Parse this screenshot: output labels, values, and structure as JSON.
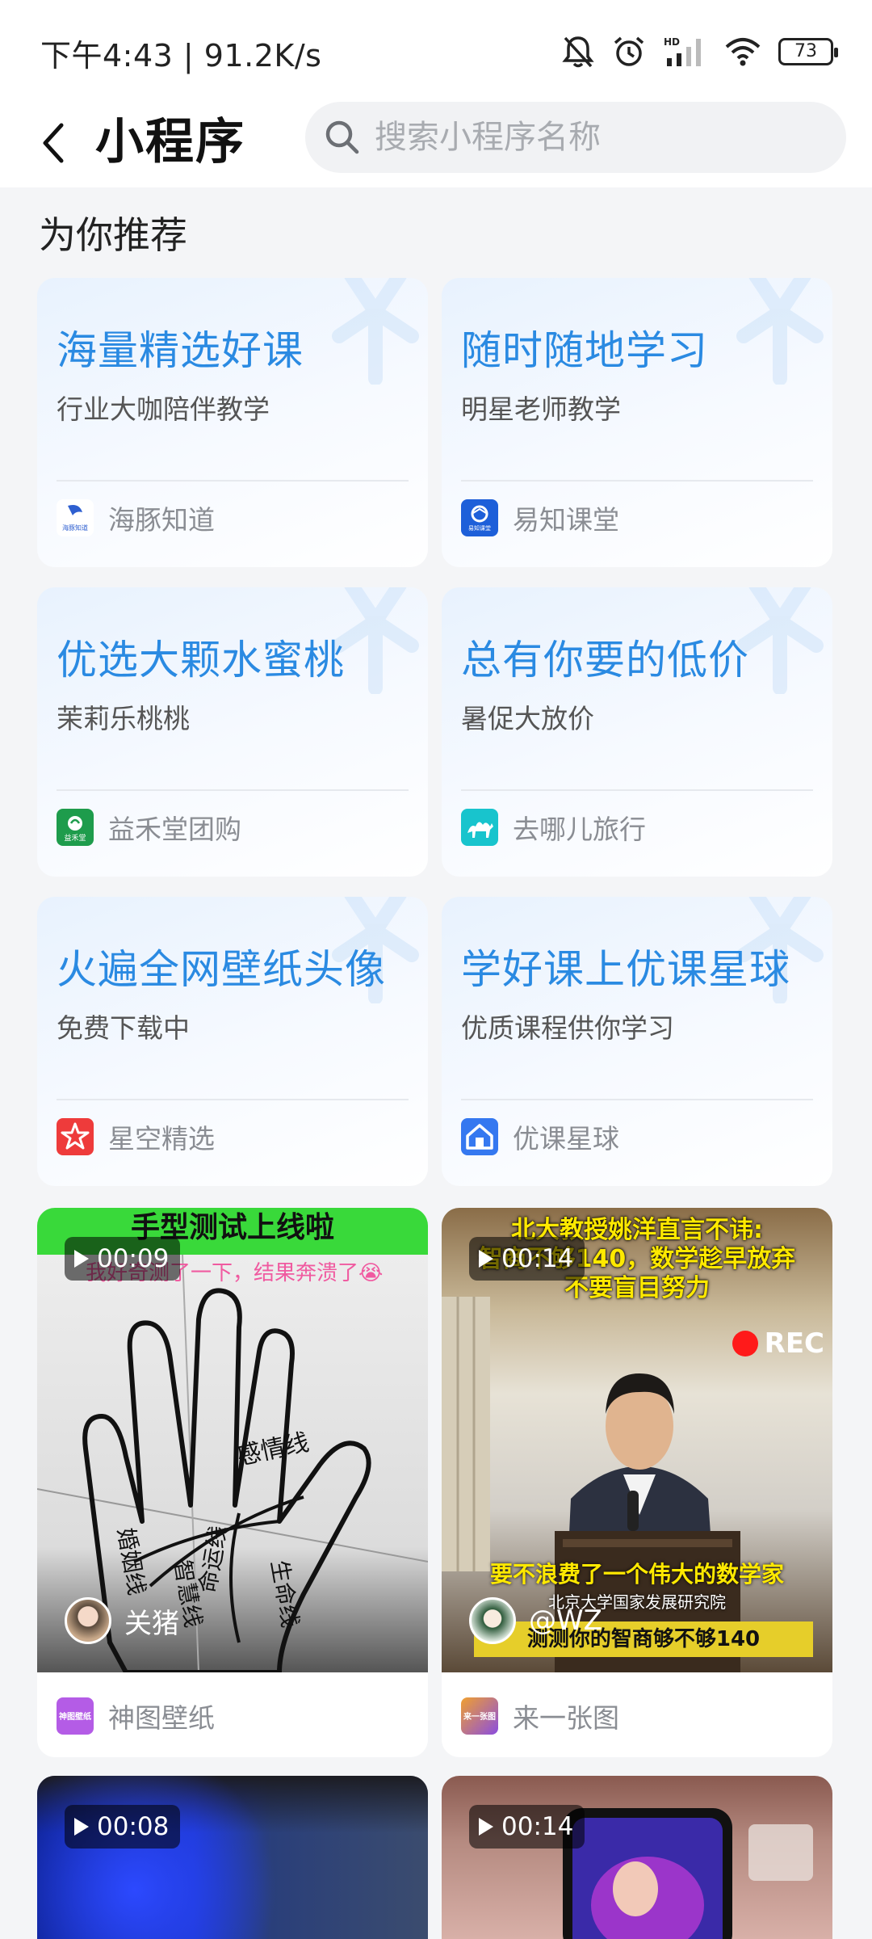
{
  "status_bar": {
    "time_speed": "下午4:43 | 91.2K/s",
    "hd": "HD",
    "battery": "73"
  },
  "header": {
    "title": "小程序",
    "search_placeholder": "搜索小程序名称"
  },
  "section": {
    "title": "为你推荐"
  },
  "recommendations": [
    {
      "title": "海量精选好课",
      "subtitle": "行业大咖陪伴教学",
      "app_name": "海豚知道",
      "icon_color": "#ffffff",
      "icon_text": "海豚知道"
    },
    {
      "title": "随时随地学习",
      "subtitle": "明星老师教学",
      "app_name": "易知课堂",
      "icon_color": "#1d5fd9",
      "icon_text": "易知课堂"
    },
    {
      "title": "优选大颗水蜜桃",
      "subtitle": "茉莉乐桃桃",
      "app_name": "益禾堂团购",
      "icon_color": "#1e9c4c",
      "icon_text": "益禾堂"
    },
    {
      "title": "总有你要的低价",
      "subtitle": "暑促大放价",
      "app_name": "去哪儿旅行",
      "icon_color": "#18c4cd",
      "icon_text": ""
    },
    {
      "title": "火遍全网壁纸头像",
      "subtitle": "免费下载中",
      "app_name": "星空精选",
      "icon_color": "#ee3b3b",
      "icon_text": ""
    },
    {
      "title": "学好课上优课星球",
      "subtitle": "优质课程供你学习",
      "app_name": "优课星球",
      "icon_color": "#3578f0",
      "icon_text": ""
    }
  ],
  "videos": [
    {
      "duration": "00:09",
      "author": "关猪",
      "app_name": "神图壁纸",
      "banner": "手型测试上线啦",
      "caption": "我好奇测了一下，结果奔溃了😭",
      "palm_labels": [
        "感情线",
        "婚姻线",
        "智慧线",
        "命运线",
        "生命线"
      ],
      "app_icon_text": "神图壁纸",
      "app_icon_color": "#b45ce6"
    },
    {
      "duration": "00:14",
      "author": "@WZ",
      "app_name": "来一张图",
      "caption_top_1": "北大教授姚洋直言不讳:",
      "caption_top_2": "智商不够140，数学趁早放弃",
      "caption_top_3": "不要盲目努力",
      "rec": "REC",
      "caption_bottom": "要不浪费了一个伟大的数学家",
      "caption_small": "北京大学国家发展研究院",
      "caption_bottom_2": "测测你的智商够不够140",
      "app_icon_text": "来一张图",
      "app_icon_color": "#8a4de0"
    },
    {
      "duration": "00:08"
    },
    {
      "duration": "00:14"
    }
  ]
}
